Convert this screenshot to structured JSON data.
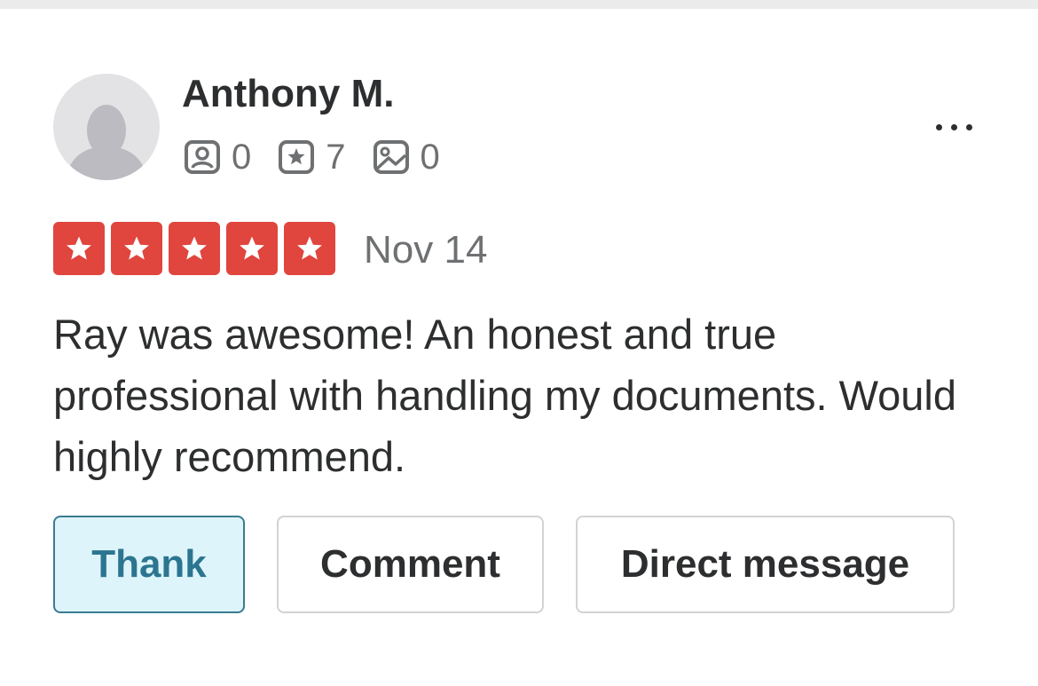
{
  "review": {
    "user": {
      "name": "Anthony M.",
      "avatar_icon": "default-user-avatar",
      "stats": [
        {
          "icon": "friends-icon",
          "value": "0"
        },
        {
          "icon": "reviews-icon",
          "value": "7"
        },
        {
          "icon": "photos-icon",
          "value": "0"
        }
      ]
    },
    "more_icon": "more-options-icon",
    "rating": {
      "stars": 5,
      "max": 5,
      "color": "#e0453e"
    },
    "date": "Nov 14",
    "text": "Ray was awesome! An honest and true professional with handling my documents. Would highly recommend."
  },
  "actions": {
    "thank_label": "Thank",
    "comment_label": "Comment",
    "direct_message_label": "Direct message"
  }
}
